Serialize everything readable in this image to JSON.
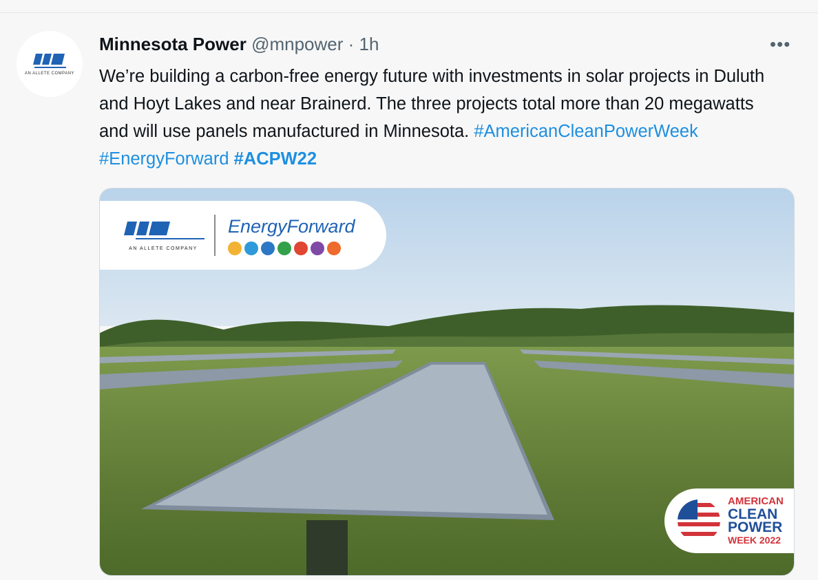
{
  "tweet": {
    "author_name": "Minnesota Power",
    "handle": "@mnpower",
    "separator": "·",
    "time": "1h",
    "more_icon": "more-horizontal-icon",
    "text_main": "We’re building a carbon-free energy future with investments in solar projects in Duluth and Hoyt Lakes and near Brainerd. The three projects total more than 20 megawatts and will use panels manufactured in Minnesota. ",
    "hashtags": [
      "#AmericanCleanPowerWeek",
      "#EnergyForward",
      "#ACPW22"
    ]
  },
  "avatar": {
    "brand": "minnesota power",
    "subtitle": "AN ALLETE COMPANY"
  },
  "media": {
    "logo_brand": "minnesota power",
    "logo_subtitle": "AN ALLETE COMPANY",
    "campaign_title": "EnergyForward",
    "campaign_icon_colors": [
      "#f2b233",
      "#2e9ad9",
      "#2d78c6",
      "#33a04a",
      "#e04632",
      "#7f4aa6",
      "#ef6a2d"
    ],
    "badge_line1": "AMERICAN",
    "badge_line2": "CLEAN",
    "badge_line3": "POWER",
    "badge_line4": "WEEK 2022"
  }
}
